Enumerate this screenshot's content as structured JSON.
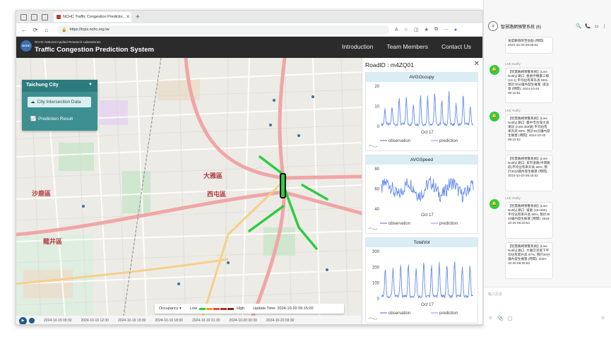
{
  "browser": {
    "tab_title": "NCHC Traffic Congestion Predictio...",
    "url": "https://tcps.nchc.org.tw"
  },
  "site": {
    "org": "NCHC National Applied Research Laboratories",
    "org_short": "NCHC",
    "title": "Traffic Congestion Prediction System",
    "nav": [
      "Introduction",
      "Team Members",
      "Contact Us"
    ]
  },
  "side_panel": {
    "city": "Taichung City",
    "buttons": [
      "City Intersection Data",
      "Prediction Result"
    ]
  },
  "map": {
    "places": [
      "大雅區",
      "西屯區",
      "沙鹿區",
      "龍井區"
    ],
    "legend": {
      "metric": "Occupancy",
      "low": "Low",
      "high": "High",
      "update_time": "Update Time: 2024-10-20 09:15:00",
      "colors": [
        "#2ecc40",
        "#f39c12",
        "#e74c3c",
        "#a93226",
        "#7b241c"
      ]
    },
    "timeline": [
      "2024-10-19 09:30",
      "2024-10-19 12:30",
      "2024-10-19 15:30",
      "2024-10-19 18:30",
      "2024-10-19 21:30",
      "2024-10-20 00:30",
      "2024-10-20 03:30"
    ]
  },
  "road_panel": {
    "title": "RoadID : m4ZQ01",
    "close": "✕",
    "legend_obs": "observation",
    "legend_pred": "prediction"
  },
  "chart_data": [
    {
      "type": "line",
      "title": "AVGOccupy",
      "xlabel": "Oct 17",
      "ylim": [
        0,
        20
      ],
      "yticks": [
        0,
        10,
        20
      ],
      "series": [
        {
          "name": "observation"
        },
        {
          "name": "prediction"
        }
      ],
      "peaks": [
        9,
        10,
        14,
        15,
        11,
        16,
        15,
        17,
        13,
        17,
        12,
        16,
        10
      ]
    },
    {
      "type": "line",
      "title": "AVGSpeed",
      "xlabel": "Oct 17",
      "ylim": [
        40,
        80
      ],
      "yticks": [
        40,
        60,
        80
      ],
      "series": [
        {
          "name": "observation"
        },
        {
          "name": "prediction"
        }
      ],
      "base": 60
    },
    {
      "type": "line",
      "title": "TotalVol",
      "xlabel": "Oct 17",
      "ylim": [
        0,
        300
      ],
      "yticks": [
        0,
        100,
        200,
        300
      ],
      "series": [
        {
          "name": "observation"
        },
        {
          "name": "prediction"
        }
      ],
      "peaks": [
        190,
        200,
        220,
        230,
        200,
        240,
        210,
        230,
        220,
        240,
        200,
        210
      ]
    }
  ],
  "chat": {
    "name": "智慧路網預警系統 (6)",
    "tools": [
      "🔍",
      "📞",
      "▭",
      "⋮"
    ],
    "messages": [
      {
        "sender": "",
        "text": "速度數值降至低點 (時間): 2024-10-20 09:05:51"
      },
      {
        "sender": "LNC Notify",
        "text": "【智慧路網預警系統】[Line Notify] 路口: 壹號手機臺三線 (18-1) 平均佔有率升高 95%, 預計30分鐘內發生擁塞, 請注意 (時間): 2024-10-20 09:10:51"
      },
      {
        "sender": "LNC Notify",
        "text": "【智慧路網預警系統】[Line Notify] 路口: 臺中市台灣大道東段 (m09-355號) 平均佔有率升高 95%, 預計30分鐘內發生擁塞 (時間): 2024-10-20 09:15:52"
      },
      {
        "sender": "",
        "text": "【智慧路網預警系統】[Line Notify] 路口: 某市道路(中港路段)平均佔有率升高 96%, 預計30分鐘內發生擁塞 (時間): 2024-10-20 09:15:53"
      },
      {
        "sender": "LNC Notify",
        "text": "【智慧路網預警系統】[Line Notify] 路口: 道路 (16+000) 平均佔有率升高 95%, 預計30分鐘內發生擁塞 (時間): 2024-10-20 09:20:53"
      },
      {
        "sender": "",
        "text": "【智慧路網預警系統】[Line Notify] 路口: 大雅交流道下平均佔有率升高 97%, 預計30分鐘內發生擁塞 (時間): 2024-10-20 09:25:53"
      }
    ],
    "input_placeholder": "輸入訊息",
    "bottom_tools": [
      "☺",
      "📎",
      "▢"
    ]
  }
}
